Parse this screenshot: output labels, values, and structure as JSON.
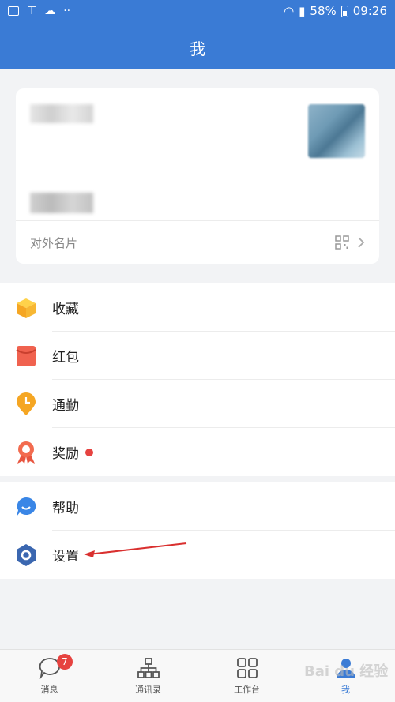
{
  "status": {
    "battery": "58%",
    "time": "09:26"
  },
  "header": {
    "title": "我"
  },
  "profile": {
    "card_label": "对外名片"
  },
  "menu_group1": [
    {
      "label": "收藏",
      "icon": "favorites-cube-icon"
    },
    {
      "label": "红包",
      "icon": "red-envelope-icon"
    },
    {
      "label": "通勤",
      "icon": "commute-clock-pin-icon"
    },
    {
      "label": "奖励",
      "icon": "award-medal-icon",
      "has_dot": true
    }
  ],
  "menu_group2": [
    {
      "label": "帮助",
      "icon": "help-chat-icon"
    },
    {
      "label": "设置",
      "icon": "settings-hexagon-icon"
    }
  ],
  "tabs": [
    {
      "label": "消息",
      "badge": "7"
    },
    {
      "label": "通讯录"
    },
    {
      "label": "工作台"
    },
    {
      "label": "我",
      "active": true
    }
  ],
  "watermark": "Bai du 经验",
  "colors": {
    "primary": "#3a7bd5",
    "badge": "#e64340",
    "background": "#f2f3f5"
  }
}
